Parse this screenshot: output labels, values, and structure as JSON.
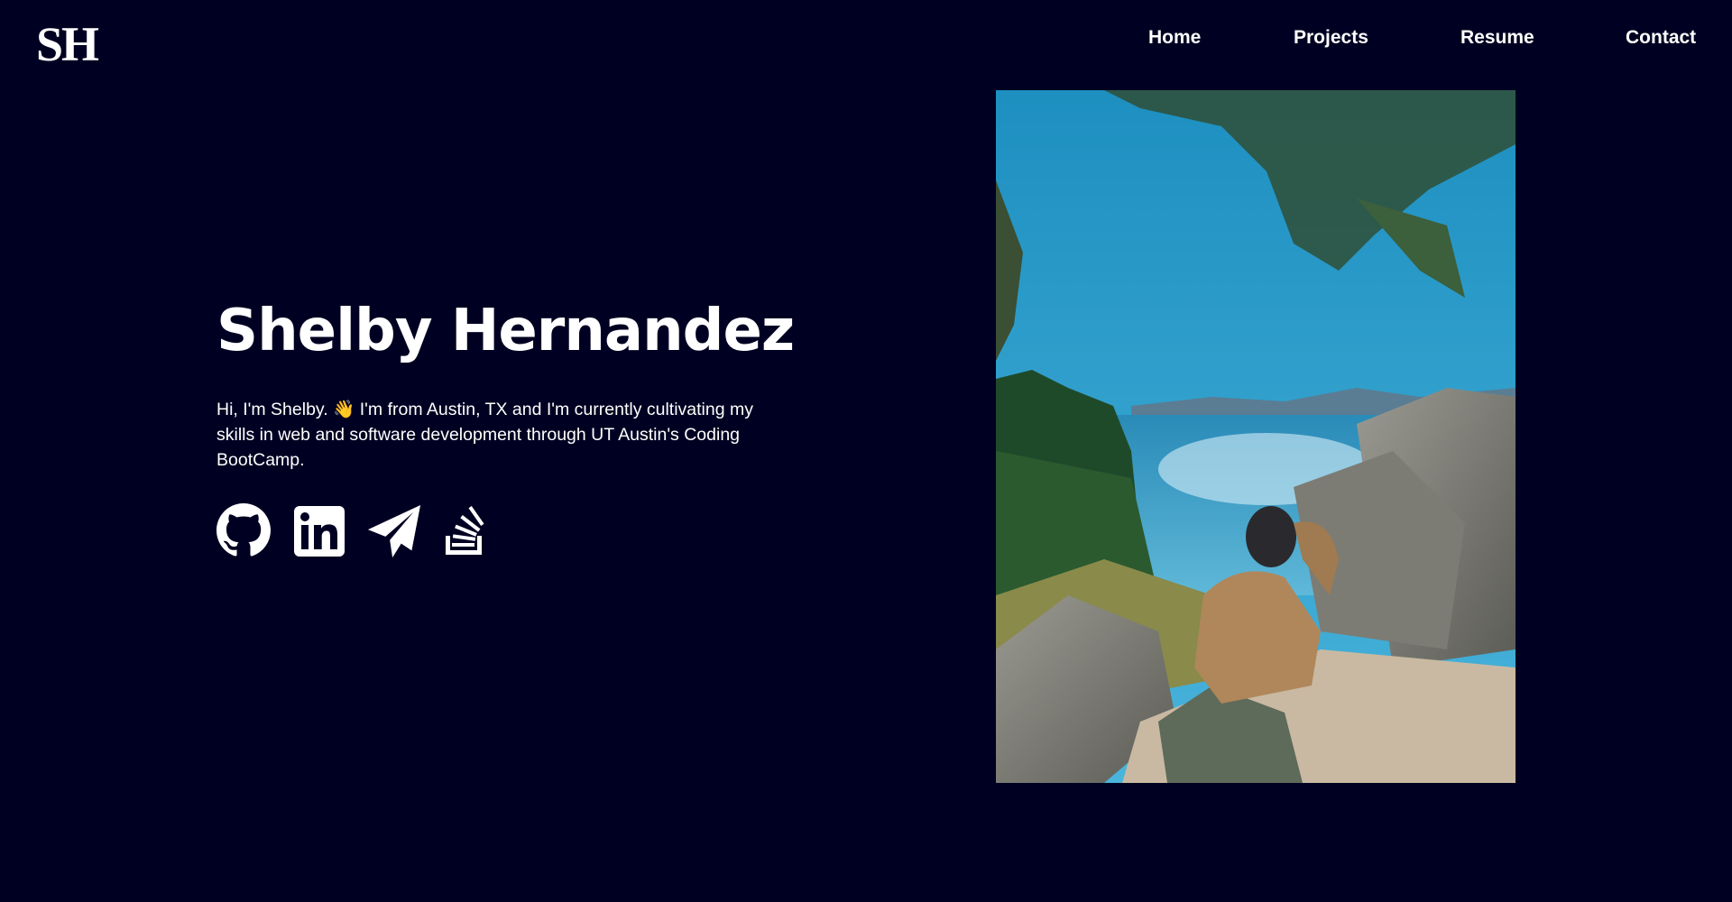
{
  "header": {
    "logo": "SH",
    "nav": [
      {
        "label": "Home"
      },
      {
        "label": "Projects"
      },
      {
        "label": "Resume"
      },
      {
        "label": "Contact"
      }
    ]
  },
  "hero": {
    "name": "Shelby Hernandez",
    "bio": "Hi, I'm Shelby. 👋 I'm from Austin, TX and I'm currently cultivating my skills in web and software development through UT Austin's Coding BootCamp."
  },
  "socials": [
    {
      "icon": "github-icon"
    },
    {
      "icon": "linkedin-icon"
    },
    {
      "icon": "telegram-icon"
    },
    {
      "icon": "stackoverflow-icon"
    }
  ],
  "colors": {
    "background": "#000022",
    "text": "#ffffff"
  }
}
